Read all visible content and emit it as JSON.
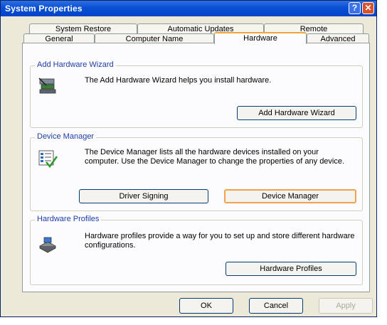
{
  "window": {
    "title": "System Properties",
    "help_glyph": "?",
    "close_glyph": "✕"
  },
  "tabs_back": [
    "System Restore",
    "Automatic Updates",
    "Remote"
  ],
  "tabs_front": [
    "General",
    "Computer Name",
    "Hardware",
    "Advanced"
  ],
  "active_tab": "Hardware",
  "groups": {
    "wizard": {
      "title": "Add Hardware Wizard",
      "description": "The Add Hardware Wizard helps you install hardware.",
      "button": "Add Hardware Wizard",
      "icon": "hardware-wizard-icon"
    },
    "device_manager": {
      "title": "Device Manager",
      "description": "The Device Manager lists all the hardware devices installed on your computer. Use the Device Manager to change the properties of any device.",
      "button_driver": "Driver Signing",
      "button_manager": "Device Manager",
      "icon": "device-manager-icon"
    },
    "profiles": {
      "title": "Hardware Profiles",
      "description": "Hardware profiles provide a way for you to set up and store different hardware configurations.",
      "button": "Hardware Profiles",
      "icon": "hardware-profiles-icon"
    }
  },
  "footer": {
    "ok": "OK",
    "cancel": "Cancel",
    "apply": "Apply"
  },
  "colors": {
    "titlebar": "#0a4fd6",
    "group_title": "#1e3da8",
    "tab_highlight": "#f3a536",
    "dialog_bg": "#ece9d8"
  }
}
